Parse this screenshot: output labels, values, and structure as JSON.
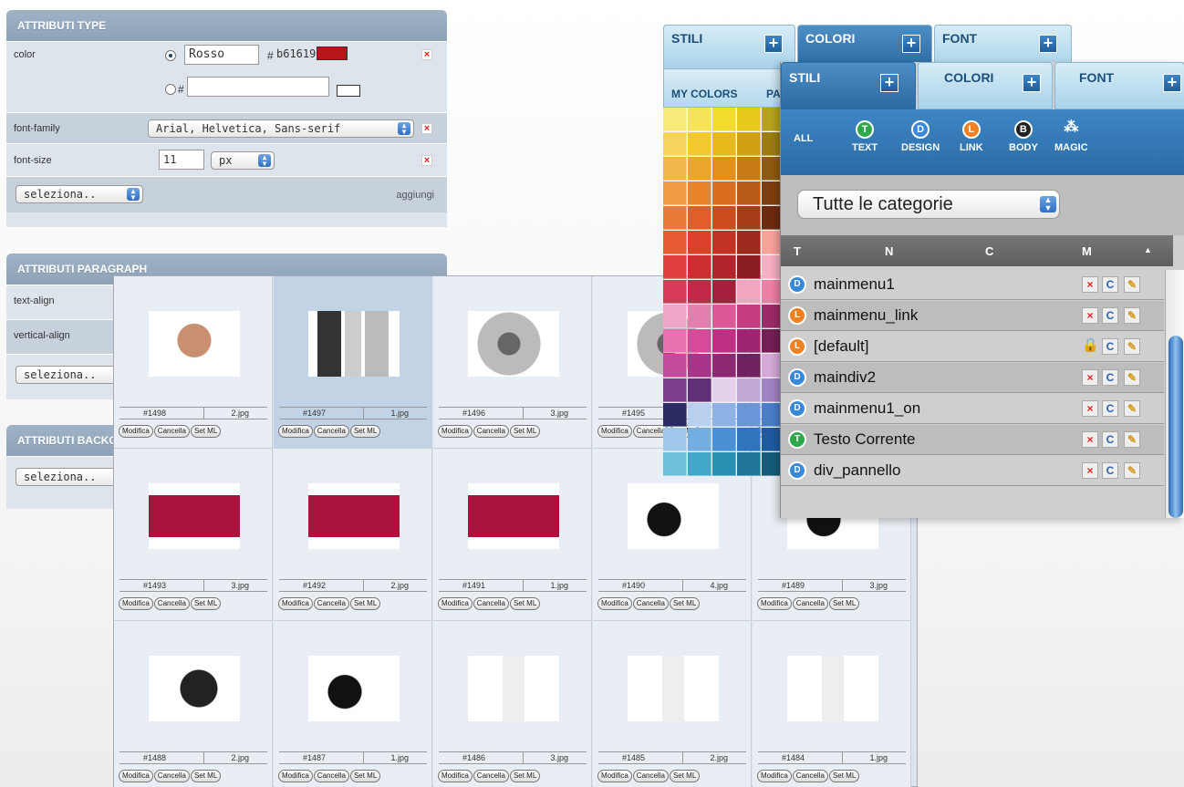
{
  "type_panel": {
    "title": "ATTRIBUTI TYPE",
    "color_label": "color",
    "color_name": "Rosso",
    "hash": "#",
    "hex": "b61619",
    "hash2": "#",
    "hex2": "",
    "swatch_color": "#b61619",
    "fontfamily_label": "font-family",
    "fontfamily_value": "Arial, Helvetica, Sans-serif",
    "fontsize_label": "font-size",
    "fontsize_value": "11",
    "fontsize_unit": "px",
    "select_placeholder": "seleziona..",
    "add_label": "aggiungi",
    "remove_icon": "×"
  },
  "paragraph_panel": {
    "title": "ATTRIBUTI PARAGRAPH",
    "textalign_label": "text-align",
    "valign_label": "vertical-align",
    "select_placeholder": "seleziona.."
  },
  "bg_panel": {
    "title": "ATTRIBUTI BACKGROUND",
    "select_placeholder": "seleziona.."
  },
  "gallery": {
    "buttons": [
      "Modifica",
      "Cancella",
      "Set ML"
    ],
    "items": [
      {
        "id": "#1498",
        "file": "2.jpg",
        "icon": "ipod-in-hand"
      },
      {
        "id": "#1497",
        "file": "1.jpg",
        "icon": "ipod-three-views"
      },
      {
        "id": "#1496",
        "file": "3.jpg",
        "icon": "silver-camera"
      },
      {
        "id": "#1495",
        "file": "",
        "icon": "silver-camera"
      },
      {
        "id": "#1494",
        "file": "",
        "icon": "camera"
      },
      {
        "id": "#1493",
        "file": "3.jpg",
        "icon": "red-sony-camera"
      },
      {
        "id": "#1492",
        "file": "2.jpg",
        "icon": "red-sony-camera"
      },
      {
        "id": "#1491",
        "file": "1.jpg",
        "icon": "red-sony-camera"
      },
      {
        "id": "#1490",
        "file": "4.jpg",
        "icon": "video-camera"
      },
      {
        "id": "#1489",
        "file": "3.jpg",
        "icon": "video-camera"
      },
      {
        "id": "#1488",
        "file": "2.jpg",
        "icon": "camcorder"
      },
      {
        "id": "#1487",
        "file": "1.jpg",
        "icon": "video-camera"
      },
      {
        "id": "#1486",
        "file": "3.jpg",
        "icon": "white-pocket-camera"
      },
      {
        "id": "#1485",
        "file": "2.jpg",
        "icon": "white-pocket-camera"
      },
      {
        "id": "#1484",
        "file": "1.jpg",
        "icon": "white-pocket-camera"
      }
    ]
  },
  "back_tabs": {
    "stili": "STILI",
    "colori": "COLORI",
    "font": "FONT",
    "plus": "+"
  },
  "colors_panel": {
    "my_colors": "MY COLORS",
    "pa": "PA"
  },
  "front_tabs": {
    "stili": "STILI",
    "colori": "COLORI",
    "font": "FONT",
    "plus": "+"
  },
  "categories": [
    {
      "label": "ALL",
      "letter": ""
    },
    {
      "label": "TEXT",
      "letter": "T"
    },
    {
      "label": "DESIGN",
      "letter": "D"
    },
    {
      "label": "LINK",
      "letter": "L"
    },
    {
      "label": "BODY",
      "letter": "B"
    },
    {
      "label": "MAGIC",
      "letter": ""
    }
  ],
  "category_select": "Tutte le categorie",
  "columns": {
    "t": "T",
    "n": "N",
    "c": "C",
    "m": "M"
  },
  "styles": [
    {
      "type": "D",
      "name": "mainmenu1",
      "locked": false
    },
    {
      "type": "L",
      "name": "mainmenu_link",
      "locked": false
    },
    {
      "type": "L",
      "name": "[default]",
      "locked": true
    },
    {
      "type": "D",
      "name": "maindiv2",
      "locked": false
    },
    {
      "type": "D",
      "name": "mainmenu1_on",
      "locked": false
    },
    {
      "type": "T",
      "name": "Testo Corrente",
      "locked": false
    },
    {
      "type": "D",
      "name": "div_pannello",
      "locked": false
    }
  ],
  "row_actions": {
    "delete": "×",
    "copy": "C"
  }
}
